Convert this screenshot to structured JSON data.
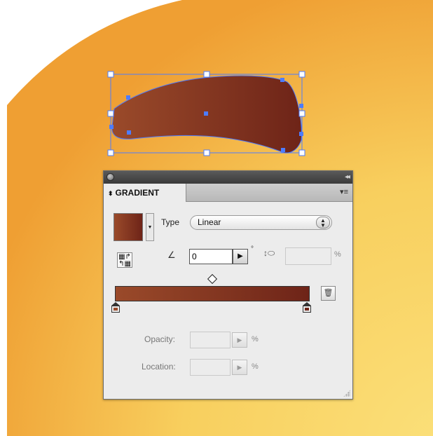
{
  "panel": {
    "tab_title": "GRADIENT",
    "type_label": "Type",
    "type_value": "Linear",
    "angle_value": "0",
    "degree_symbol": "°",
    "aspect_percent": "%",
    "opacity_label": "Opacity:",
    "opacity_unit": "%",
    "location_label": "Location:",
    "location_unit": "%"
  },
  "gradient": {
    "start_color": "#9a4a2a",
    "end_color": "#6e2418"
  },
  "artboard": {
    "background_light": "#f9dc6e",
    "background_dark": "#f0a93a",
    "selection_color": "#4d7cff"
  },
  "icons": {
    "close": "close-icon",
    "collapse": "double-chevron-icon",
    "panel_menu": "panel-menu-icon",
    "angle": "angle-icon",
    "aspect": "aspect-ratio-icon",
    "reverse": "reverse-gradient-icon",
    "trash": "trash-icon"
  }
}
